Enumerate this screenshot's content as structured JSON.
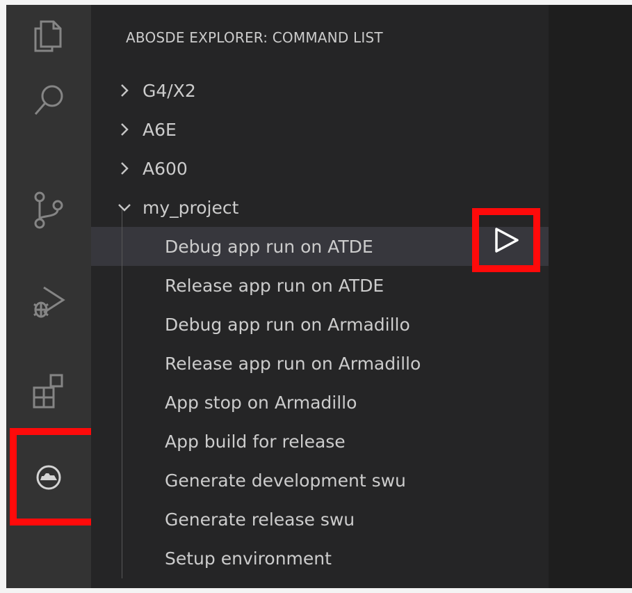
{
  "activity_bar": {
    "icons": [
      "explorer-icon",
      "search-icon",
      "source-control-icon",
      "run-debug-icon",
      "extensions-icon",
      "abosde-icon"
    ]
  },
  "sidebar": {
    "title": "ABOSDE EXPLORER: COMMAND LIST",
    "groups": [
      {
        "label": "G4/X2",
        "expanded": false
      },
      {
        "label": "A6E",
        "expanded": false
      },
      {
        "label": "A600",
        "expanded": false
      },
      {
        "label": "my_project",
        "expanded": true
      }
    ],
    "commands": [
      "Debug app run on ATDE",
      "Release app run on ATDE",
      "Debug app run on Armadillo",
      "Release app run on Armadillo",
      "App stop on Armadillo",
      "App build for release",
      "Generate development swu",
      "Generate release swu",
      "Setup environment"
    ]
  },
  "colors": {
    "highlight": "#ff0a0a",
    "activity_bar": "#333333",
    "sidebar": "#252526",
    "editor": "#1e1e1e",
    "selection": "#37373d"
  }
}
